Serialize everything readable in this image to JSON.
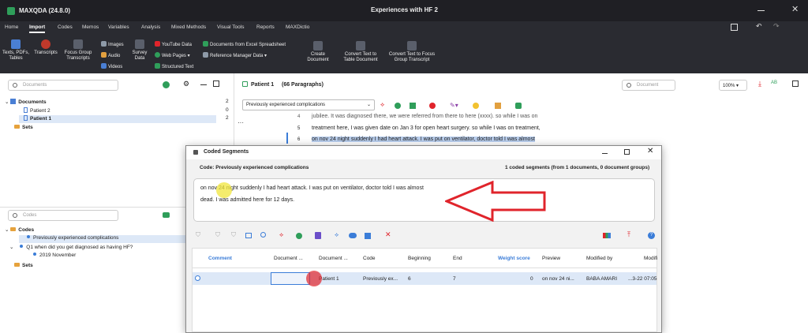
{
  "window": {
    "app": "MAXQDA (24.8.0)",
    "title": "Experiences with HF 2"
  },
  "menu": [
    "Home",
    "Import",
    "Codes",
    "Memos",
    "Variables",
    "Analysis",
    "Mixed Methods",
    "Visual Tools",
    "Reports",
    "MAXDictio"
  ],
  "menu_active": "Import",
  "ribbon": {
    "texts": "Texts, PDFs,\nTables",
    "transcripts": "Transcripts",
    "focus": "Focus Group\nTranscripts",
    "images": "Images",
    "audio": "Audio",
    "videos": "Videos",
    "survey": "Survey\nData",
    "youtube": "YouTube Data",
    "webpages": "Web Pages",
    "structured": "Structured Text",
    "excel": "Documents from Excel Spreadsheet",
    "refmgr": "Reference Manager Data",
    "create": "Create\nDocument",
    "convert_table": "Convert Text to\nTable Document",
    "convert_focus": "Convert Text to Focus\nGroup Transcript"
  },
  "documents": {
    "search_placeholder": "Documents",
    "items": [
      {
        "label": "Documents",
        "count": "2"
      },
      {
        "label": "Patient 2",
        "count": "0"
      },
      {
        "label": "Patient 1",
        "count": "2"
      },
      {
        "label": "Sets",
        "count": ""
      }
    ]
  },
  "codes": {
    "search_placeholder": "Codes",
    "items": [
      {
        "label": "Codes"
      },
      {
        "label": "Previously experienced complications"
      },
      {
        "label": "Q1 when did you get diagnosed as having HF?"
      },
      {
        "label": "2019 November"
      },
      {
        "label": "Sets"
      }
    ]
  },
  "browser": {
    "title": "Patient 1",
    "paragraphs": "(66 Paragraphs)",
    "search_placeholder": "Document",
    "zoom": "100%",
    "code_select": "Previously experienced complications",
    "lines": [
      {
        "n": "4",
        "text": "jubilee. It was diagnosed there, we were referred from there to here (xxxx). so while I was on"
      },
      {
        "n": "5",
        "text": "treatment here, I was given date on Jan 3 for open heart surgery. so while I was on treatment,"
      },
      {
        "n": "6",
        "text": "on nov 24 night suddenly I had heart attack. I was put on ventilator, doctor told I was almost"
      }
    ]
  },
  "dialog": {
    "title": "Coded Segments",
    "code_line": "Code: Previously experienced complications",
    "summary": "1 coded segments (from 1 documents, 0 document groups)",
    "text_line1": "on nov 24 night suddenly I had heart attack. I was put on ventilator, doctor told I was almost",
    "text_line2": "dead. I was admitted here for 12 days.",
    "columns": [
      "Comment",
      "Document ...",
      "Document ...",
      "Code",
      "Beginning",
      "End",
      "Weight score",
      "Preview",
      "Modified by",
      "Modifi"
    ],
    "row": {
      "comment": "",
      "doc_group": "",
      "doc_name": "Patient 1",
      "code": "Previously ex...",
      "beginning": "6",
      "end": "7",
      "weight": "0",
      "preview": "on nov 24 ni...",
      "modified_by": "BABA AMARI",
      "modified": "...3-22 07:05"
    }
  },
  "colors": {
    "accent": "#3b7dd8",
    "arrow": "#e0242b",
    "titlebar": "#1f1f24",
    "ribbon": "#2a2b31"
  }
}
